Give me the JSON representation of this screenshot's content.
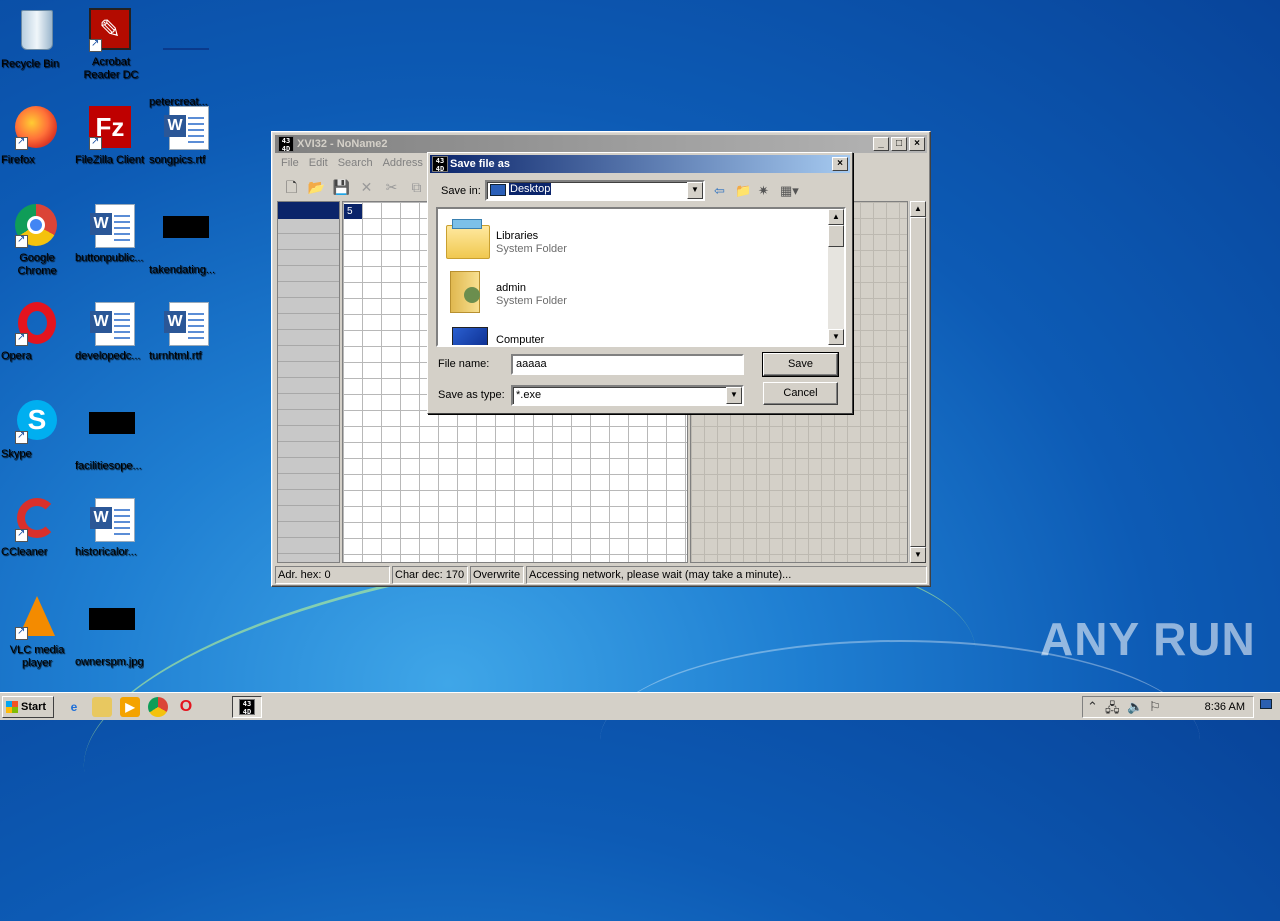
{
  "desktop": {
    "icons": [
      {
        "label": "Recycle Bin"
      },
      {
        "label": "Acrobat Reader DC"
      },
      {
        "label": "petercreat..."
      },
      {
        "label": "Firefox"
      },
      {
        "label": "FileZilla Client"
      },
      {
        "label": "songpics.rtf"
      },
      {
        "label": "Google Chrome"
      },
      {
        "label": "buttonpublic..."
      },
      {
        "label": "takendating..."
      },
      {
        "label": "Opera"
      },
      {
        "label": "developedc..."
      },
      {
        "label": "turnhtml.rtf"
      },
      {
        "label": "Skype"
      },
      {
        "label": "facilitiesope..."
      },
      {
        "label": "CCleaner"
      },
      {
        "label": "historicalor..."
      },
      {
        "label": "VLC media player"
      },
      {
        "label": "ownerspm.jpg"
      }
    ]
  },
  "main_window": {
    "title": "XVI32 - NoName2",
    "app_icon_text": "4 3 4 D",
    "menu": [
      "File",
      "Edit",
      "Search",
      "Address"
    ],
    "hex_cell_value": "5",
    "status": {
      "address": "Adr. hex: 0",
      "char": "Char dec: 170",
      "mode": "Overwrite",
      "message": "Accessing network, please wait (may take a minute)..."
    }
  },
  "dialog": {
    "title": "Save file as",
    "save_in_label": "Save in:",
    "save_in_value": "Desktop",
    "files": [
      {
        "name": "Libraries",
        "type": "System Folder"
      },
      {
        "name": "admin",
        "type": "System Folder"
      },
      {
        "name": "Computer",
        "type": "System Folder"
      }
    ],
    "filename_label": "File name:",
    "filename_value": "aaaaa",
    "type_label": "Save as type:",
    "type_value": "*.exe",
    "save_button": "Save",
    "cancel_button": "Cancel"
  },
  "taskbar": {
    "start_label": "Start",
    "clock": "8:36 AM"
  },
  "watermark": "ANY RUN"
}
